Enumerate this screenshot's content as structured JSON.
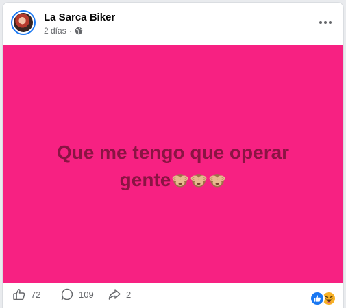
{
  "post": {
    "author": "La Sarca Biker",
    "time": "2 días",
    "separator": "·",
    "audience_icon": "globe-icon",
    "text": "Que me tengo que operar gente",
    "emojis": [
      "see-no-evil-monkey",
      "see-no-evil-monkey",
      "see-no-evil-monkey"
    ],
    "background_color": "#f72182",
    "text_color": "#8a1443"
  },
  "actions": {
    "likes": "72",
    "comments": "109",
    "shares": "2"
  },
  "reactions": [
    "like",
    "haha"
  ],
  "colors": {
    "accent": "#1877f2",
    "muted": "#65676b"
  }
}
